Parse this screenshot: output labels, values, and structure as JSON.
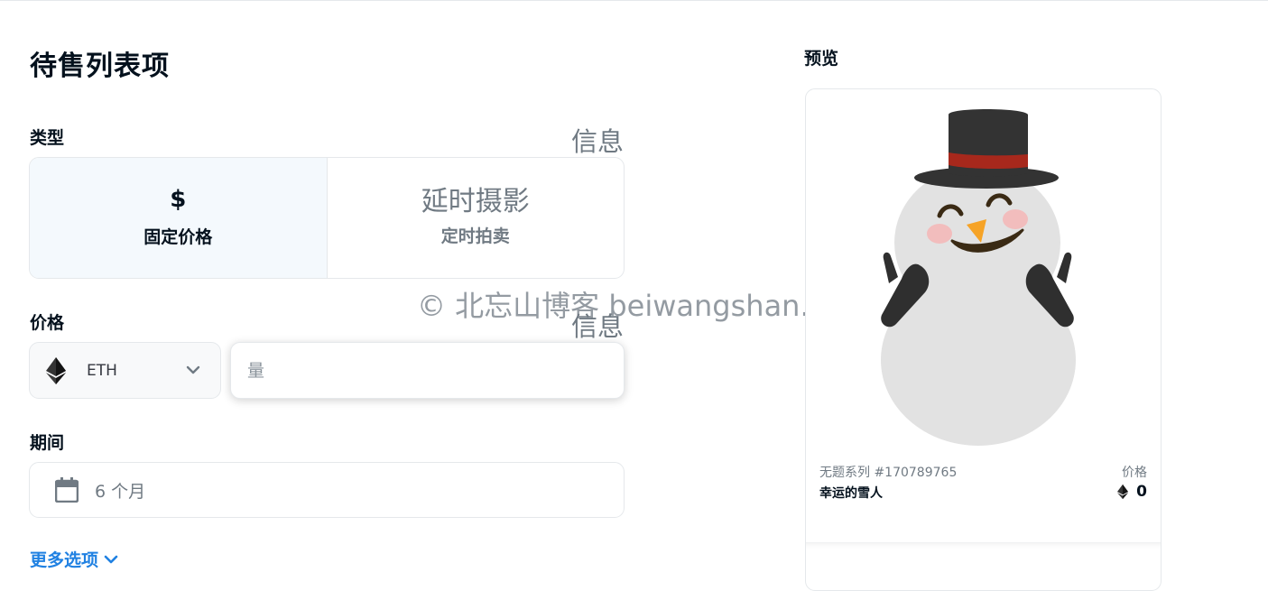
{
  "page": {
    "title": "待售列表项",
    "watermark": "© 北忘山博客 beiwangshan.com"
  },
  "type_section": {
    "label": "类型",
    "info": "信息",
    "options": [
      {
        "icon": "dollar-icon",
        "icon_glyph": "$",
        "label": "固定价格",
        "selected": true
      },
      {
        "icon": "timed-auction-icon",
        "icon_glyph": "延时摄影",
        "label": "定时拍卖",
        "selected": false
      }
    ]
  },
  "price_section": {
    "label": "价格",
    "info": "信息",
    "currency": "ETH",
    "amount_placeholder": "量",
    "amount_value": ""
  },
  "duration_section": {
    "label": "期间",
    "value": "6 个月"
  },
  "more_options": {
    "label": "更多选项"
  },
  "preview": {
    "label": "预览",
    "collection": "无题系列 #170789765",
    "name": "幸运的雪人",
    "price_label": "价格",
    "price_value": "0"
  },
  "colors": {
    "accent": "#2081e2",
    "selected_bg": "#f4f9fd",
    "border": "#e5e8eb",
    "text_primary": "#04111d",
    "text_secondary": "#707a83"
  }
}
